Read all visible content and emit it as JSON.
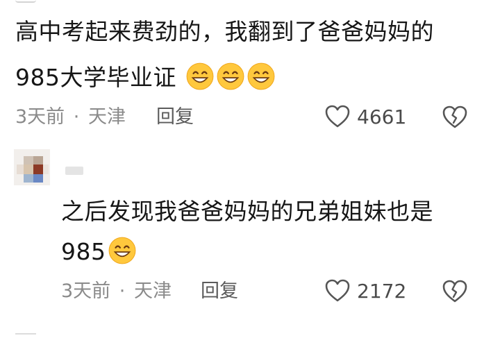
{
  "comment1": {
    "line1": "高中考起来费劲的，我翻到了爸爸妈妈的",
    "line2": "985大学毕业证",
    "emoji_count": 3,
    "emoji_icon": "grinning-face-icon",
    "time": "3天前",
    "separator": "·",
    "location": "天津",
    "reply_label": "回复",
    "likes": "4661",
    "like_icon": "heart-icon",
    "dislike_icon": "broken-heart-icon"
  },
  "reply1": {
    "avatar_icon": "blurred-avatar",
    "line1": "之后发现我爸爸妈妈的兄弟姐妹也是",
    "line2": "985",
    "emoji_count": 1,
    "emoji_icon": "grinning-face-icon",
    "time": "3天前",
    "separator": "·",
    "location": "天津",
    "reply_label": "回复",
    "likes": "2172",
    "like_icon": "heart-icon",
    "dislike_icon": "broken-heart-icon"
  },
  "colors": {
    "text": "#161616",
    "meta": "#8a8a8a",
    "emoji_face": "#ffc83d"
  }
}
